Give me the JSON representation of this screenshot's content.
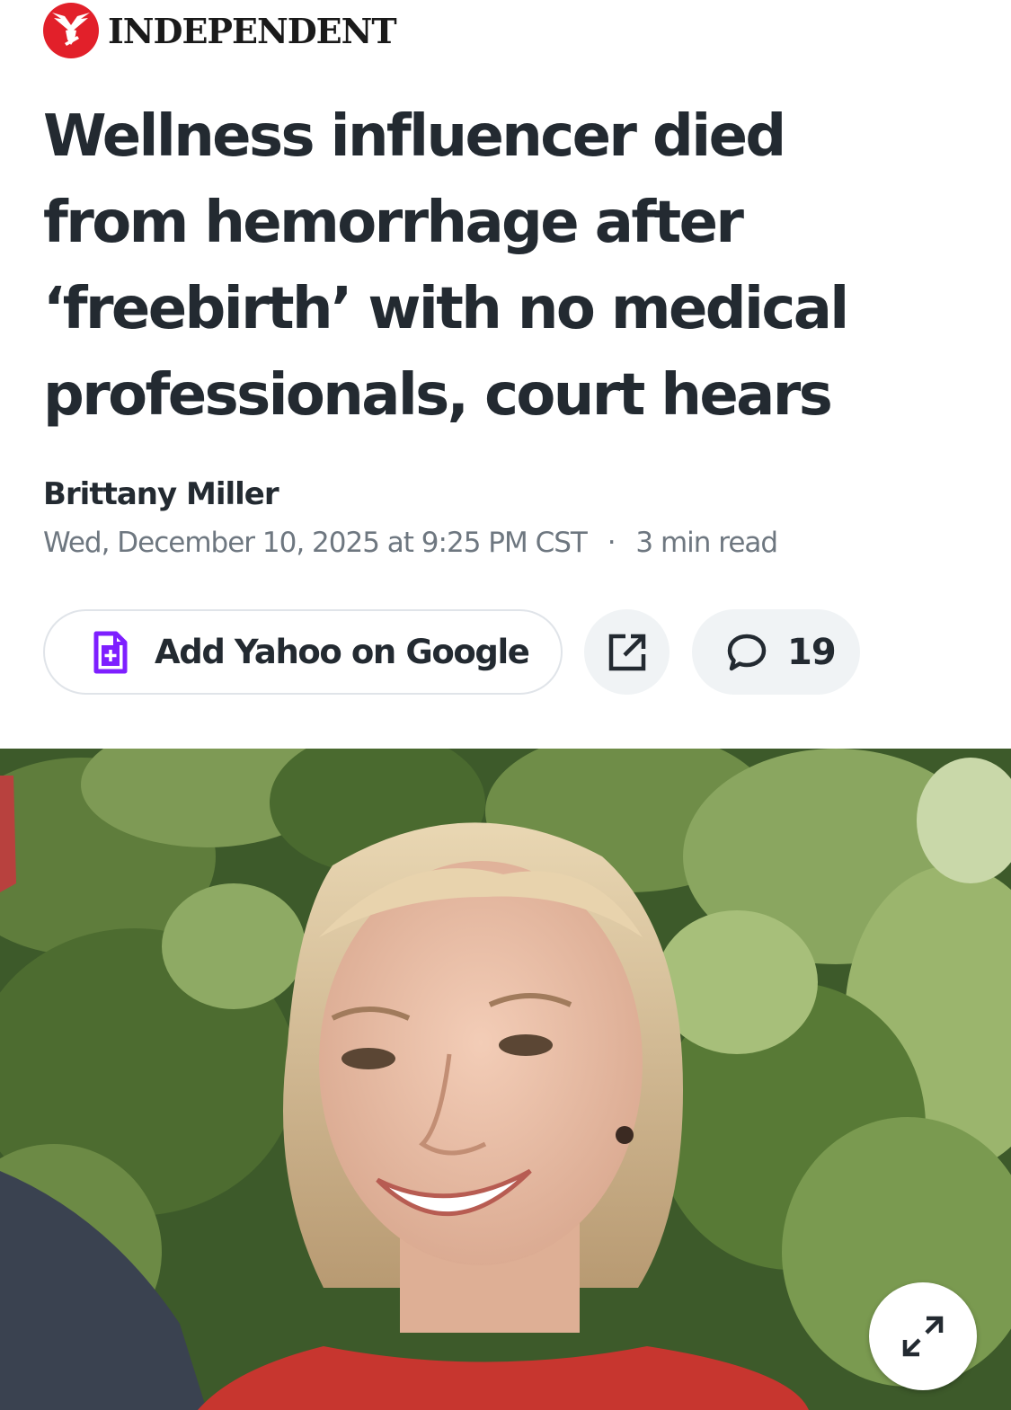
{
  "masthead": {
    "brand": "INDEPENDENT",
    "logo_icon": "eagle-icon",
    "logo_color": "#e2202a"
  },
  "article": {
    "headline_lines": [
      "Wellness influencer died",
      "from hemorrhage after",
      "‘freebirth’ with no medical",
      "professionals, court hears"
    ],
    "author": "Brittany Miller",
    "date": "Wed, December 10, 2025 at 9:25 PM CST",
    "separator": "·",
    "read_time": "3 min read"
  },
  "actions": {
    "add_label": "Add Yahoo on Google",
    "add_icon": "add-document-icon",
    "add_icon_color": "#7e1fff",
    "share_icon": "share-external-icon",
    "comment_icon": "comment-bubble-icon",
    "comment_count": "19"
  },
  "image": {
    "expand_icon": "expand-icon"
  }
}
